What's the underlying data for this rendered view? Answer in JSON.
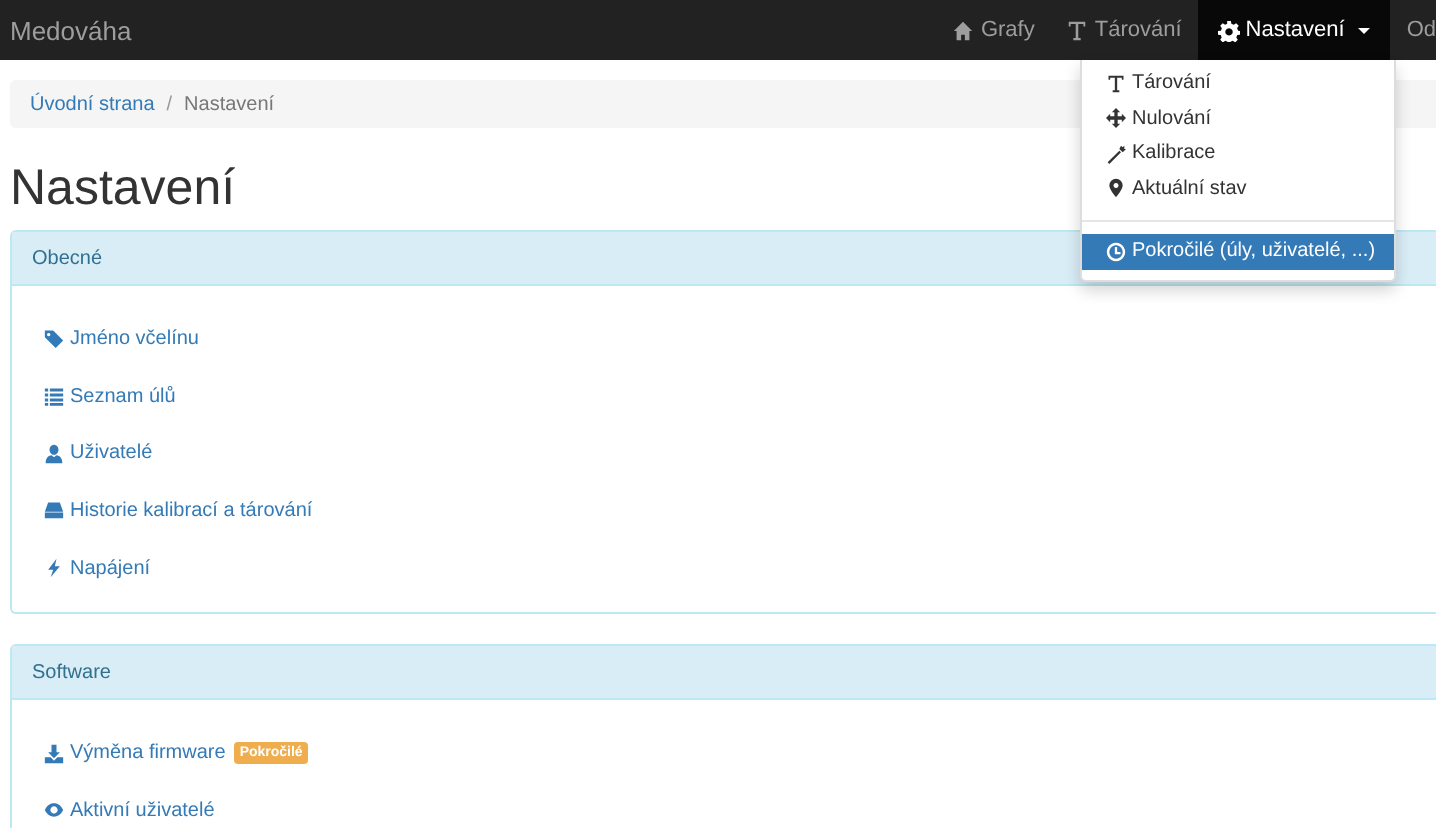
{
  "navbar": {
    "brand": "Medováha",
    "items": [
      {
        "label": "Grafy",
        "selected": false
      },
      {
        "label": "Tárování",
        "selected": false
      },
      {
        "label": "Nastavení",
        "selected": true,
        "expanded": true
      },
      {
        "label": "Od",
        "selected": false
      }
    ]
  },
  "dropdown": {
    "items": [
      {
        "label": "Tárování",
        "selected": false
      },
      {
        "label": "Nulování",
        "selected": false
      },
      {
        "label": "Kalibrace",
        "selected": false
      },
      {
        "label": "Aktuální stav",
        "selected": false
      },
      {
        "label": "Pokročilé (úly, uživatelé, ...)",
        "selected": true
      }
    ]
  },
  "breadcrumb": [
    {
      "label": "Úvodní strana",
      "kind": "link"
    },
    {
      "label": "/",
      "kind": "separator"
    },
    {
      "label": "Nastavení",
      "kind": "current"
    }
  ],
  "title": "Nastavení",
  "panels": [
    {
      "heading": "Obecné",
      "items": [
        {
          "label": "Jméno včelínu"
        },
        {
          "label": "Seznam úlů"
        },
        {
          "label": "Uživatelé"
        },
        {
          "label": "Historie kalibrací a tárování"
        },
        {
          "label": "Napájení"
        }
      ]
    },
    {
      "heading": "Software",
      "items": [
        {
          "label": "Výměna firmware",
          "badge": "Pokročilé"
        },
        {
          "label": "Aktivní uživatelé"
        }
      ]
    }
  ]
}
